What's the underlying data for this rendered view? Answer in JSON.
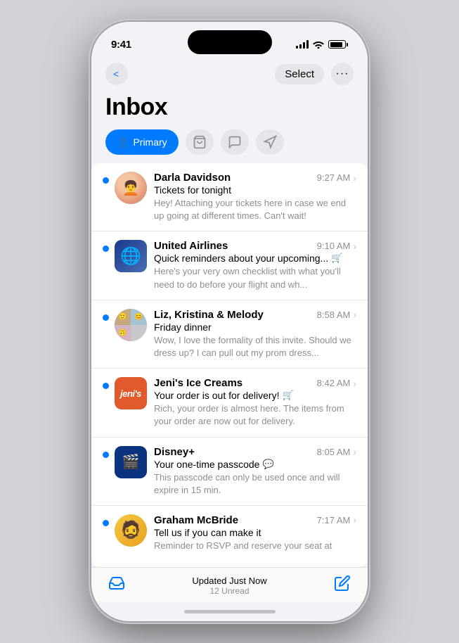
{
  "phone": {
    "status_bar": {
      "time": "9:41",
      "signal_label": "signal",
      "wifi_label": "wifi",
      "battery_label": "battery"
    },
    "nav": {
      "back_label": "Back",
      "select_label": "Select",
      "more_label": "···"
    },
    "header": {
      "title": "Inbox"
    },
    "tabs": [
      {
        "id": "primary",
        "label": "Primary",
        "icon": "person",
        "active": true
      },
      {
        "id": "shopping",
        "label": "Shopping",
        "icon": "cart",
        "active": false
      },
      {
        "id": "social",
        "label": "Social",
        "icon": "message",
        "active": false
      },
      {
        "id": "promotions",
        "label": "Promotions",
        "icon": "megaphone",
        "active": false
      }
    ],
    "emails": [
      {
        "id": 1,
        "sender": "Darla Davidson",
        "subject": "Tickets for tonight",
        "preview": "Hey! Attaching your tickets here in case we end up going at different times. Can't wait!",
        "time": "9:27 AM",
        "unread": true,
        "avatar_type": "darla",
        "badge": null
      },
      {
        "id": 2,
        "sender": "United Airlines",
        "subject": "Quick reminders about your upcoming...",
        "preview": "Here's your very own checklist with what you'll need to do before your flight and wh...",
        "time": "9:10 AM",
        "unread": true,
        "avatar_type": "united",
        "badge": "cart"
      },
      {
        "id": 3,
        "sender": "Liz, Kristina & Melody",
        "subject": "Friday dinner",
        "preview": "Wow, I love the formality of this invite. Should we dress up? I can pull out my prom dress...",
        "time": "8:58 AM",
        "unread": true,
        "avatar_type": "group",
        "badge": null
      },
      {
        "id": 4,
        "sender": "Jeni's Ice Creams",
        "subject": "Your order is out for delivery!",
        "preview": "Rich, your order is almost here. The items from your order are now out for delivery.",
        "time": "8:42 AM",
        "unread": true,
        "avatar_type": "jenis",
        "badge": "cart"
      },
      {
        "id": 5,
        "sender": "Disney+",
        "subject": "Your one-time passcode",
        "preview": "This passcode can only be used once and will expire in 15 min.",
        "time": "8:05 AM",
        "unread": true,
        "avatar_type": "disney",
        "badge": "message"
      },
      {
        "id": 6,
        "sender": "Graham McBride",
        "subject": "Tell us if you can make it",
        "preview": "Reminder to RSVP and reserve your seat at",
        "time": "7:17 AM",
        "unread": true,
        "avatar_type": "graham",
        "badge": null
      }
    ],
    "bottom_bar": {
      "updated_label": "Updated Just Now",
      "unread_label": "12 Unread",
      "compose_icon": "compose"
    }
  }
}
